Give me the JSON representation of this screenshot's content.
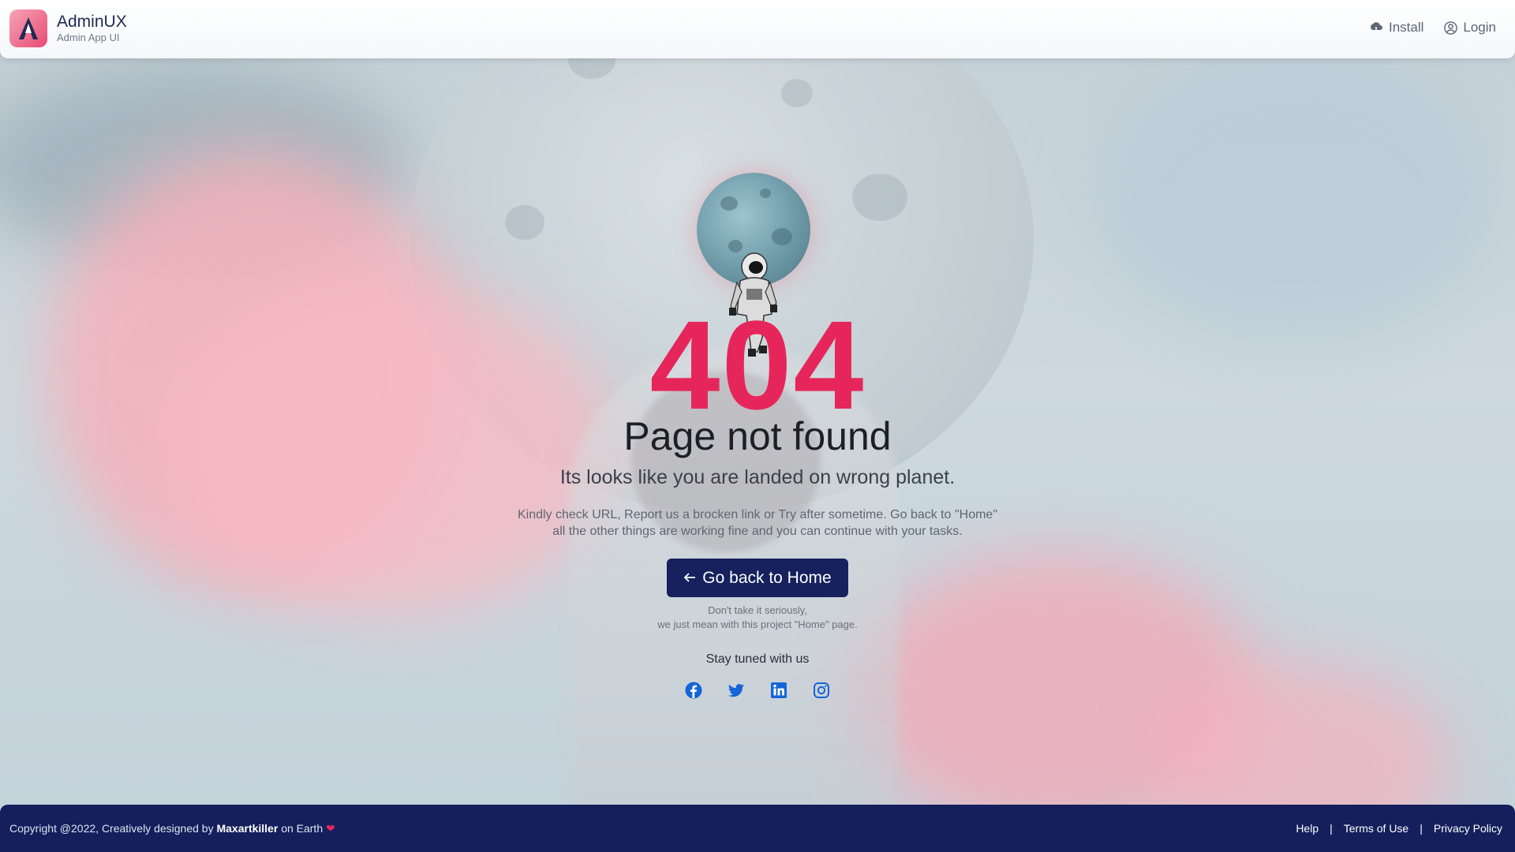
{
  "header": {
    "brand_title": "AdminUX",
    "brand_subtitle": "Admin App UI",
    "install_label": "Install",
    "login_label": "Login"
  },
  "main": {
    "code": "404",
    "title": "Page not found",
    "subtitle": "Its looks like you are landed on wrong planet.",
    "description": "Kindly check URL, Report us a brocken link or Try after sometime. Go back to \"Home\" all the other things are working fine and you can continue with your tasks.",
    "home_button_label": "Go back to Home",
    "note_line1": "Don't take it seriously,",
    "note_line2": "we just mean with this project \"Home\" page.",
    "stay_tuned": "Stay tuned with us",
    "social_icons": [
      "facebook-icon",
      "twitter-icon",
      "linkedin-icon",
      "instagram-icon"
    ]
  },
  "footer": {
    "copyright_prefix": "Copyright @2022, Creatively designed by",
    "designer": "Maxartkiller",
    "copyright_suffix": "on Earth",
    "links": [
      "Help",
      "Terms of Use",
      "Privacy Policy"
    ]
  },
  "colors": {
    "accent": "#e6265a",
    "primary": "#16215e",
    "footer_bg": "#141f5c",
    "social": "#1565d8"
  }
}
